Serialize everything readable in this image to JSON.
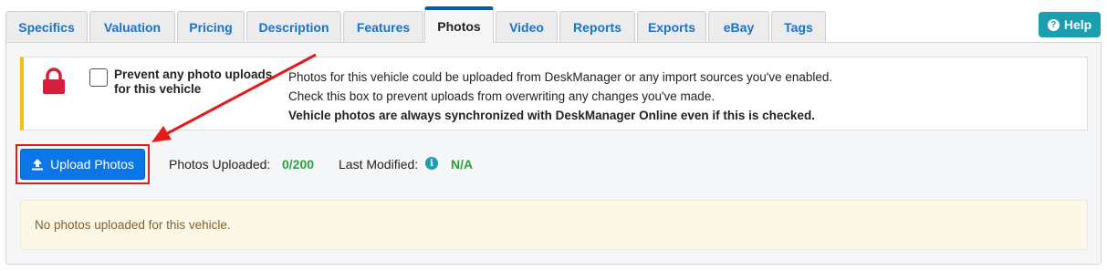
{
  "tabs": [
    {
      "label": "Specifics"
    },
    {
      "label": "Valuation"
    },
    {
      "label": "Pricing"
    },
    {
      "label": "Description"
    },
    {
      "label": "Features"
    },
    {
      "label": "Photos",
      "active": true
    },
    {
      "label": "Video"
    },
    {
      "label": "Reports"
    },
    {
      "label": "Exports"
    },
    {
      "label": "eBay"
    },
    {
      "label": "Tags"
    }
  ],
  "help": {
    "label": "Help",
    "icon": "question-circle-icon"
  },
  "lock_notice": {
    "icon": "lock-icon",
    "checkbox_label": "Prevent any photo uploads for this vehicle",
    "checked": false,
    "line1": "Photos for this vehicle could be uploaded from DeskManager or any import sources you've enabled.",
    "line2": "Check this box to prevent uploads from overwriting any changes you've made.",
    "line3": "Vehicle photos are always synchronized with DeskManager Online even if this is checked."
  },
  "upload": {
    "label": "Upload Photos",
    "icon": "upload-icon"
  },
  "stats": {
    "photos_uploaded_label": "Photos Uploaded:",
    "photos_uploaded_value": "0/200",
    "last_modified_label": "Last Modified:",
    "last_modified_value": "N/A"
  },
  "empty_message": "No photos uploaded for this vehicle.",
  "colors": {
    "tab_link": "#1a73c9",
    "active_tab_border": "#0c5aa6",
    "help_button": "#1b9fb0",
    "upload_button": "#0b76e8",
    "lock_icon": "#d81e3a",
    "notice_border": "#f4c20d",
    "success_green": "#2e9e43",
    "annotation_red": "#e41b1b",
    "empty_bg": "#fcf8e6"
  }
}
